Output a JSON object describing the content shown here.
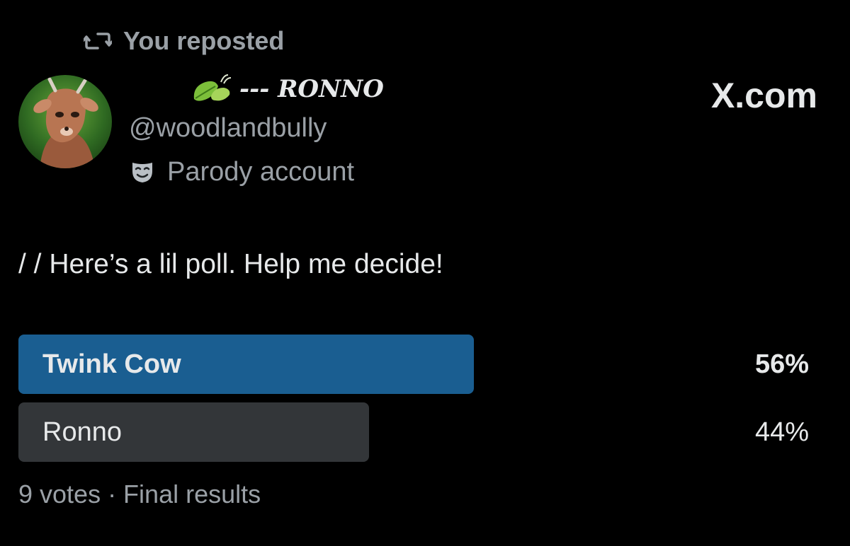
{
  "colors": {
    "background": "#000000",
    "primary_text": "#e7e9ea",
    "secondary_text": "#9aa0a6",
    "winner_bar": "#1a5e91",
    "other_bar": "#333639"
  },
  "repost": {
    "icon": "repost-icon",
    "label": "You reposted"
  },
  "author": {
    "display_name_icon": "leaf-icon",
    "display_name": "--- RONNO",
    "handle": "@woodlandbully",
    "badge_icon": "parody-mask-icon",
    "badge_label": "Parody account",
    "avatar": "deer-avatar"
  },
  "site_logo": "X.com",
  "tweet": {
    "text": "/ / Here’s a lil poll. Help me decide!"
  },
  "poll": {
    "options": [
      {
        "label": "Twink Cow",
        "percent_label": "56%",
        "percent": 56,
        "winner": true
      },
      {
        "label": "Ronno",
        "percent_label": "44%",
        "percent": 44,
        "winner": false
      }
    ],
    "footer": "9 votes · Final results"
  }
}
